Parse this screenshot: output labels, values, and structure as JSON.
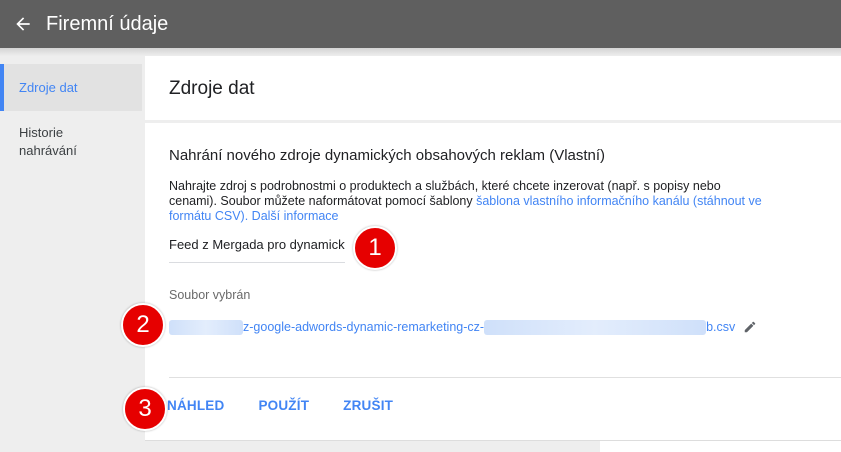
{
  "header": {
    "title": "Firemní údaje"
  },
  "sidebar": {
    "items": [
      {
        "label": "Zdroje dat"
      },
      {
        "label": "Historie nahrávání"
      }
    ]
  },
  "main": {
    "title": "Zdroje dat"
  },
  "card": {
    "title": "Nahrání nového zdroje dynamických obsahových reklam (Vlastní)",
    "desc_text": "Nahrajte zdroj s podrobnostmi o produktech a službách, které chcete inzerovat (např. s popisy nebo cenami). Soubor můžete naformátovat pomocí šablony ",
    "template_link": "šablona vlastního informačního kanálu (stáhnout ve formátu CSV).",
    "more_link": "Další informace",
    "feed_name": "Feed z Mergada pro dynamický",
    "file_label": "Soubor vybrán",
    "file_name_middle": "z-google-adwords-dynamic-remarketing-cz-",
    "file_name_end": "b.csv"
  },
  "actions": {
    "preview": "NÁHLED",
    "apply": "POUŽÍT",
    "cancel": "ZRUŠIT"
  },
  "annotations": [
    "1",
    "2",
    "3"
  ],
  "colors": {
    "accent": "#4285f4",
    "topbar": "#5f5f5f",
    "badge": "#e60000"
  }
}
